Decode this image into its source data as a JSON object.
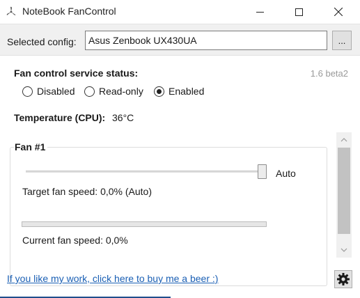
{
  "window": {
    "title": "NoteBook FanControl",
    "icons": {
      "app": "fan-app-icon",
      "minimize": "minimize-icon",
      "maximize": "maximize-icon",
      "close": "close-icon"
    }
  },
  "config": {
    "label": "Selected config:",
    "value": "Asus Zenbook UX430UA",
    "browse_label": "..."
  },
  "version": "1.6 beta2",
  "service": {
    "heading": "Fan control service status:",
    "options": [
      {
        "label": "Disabled",
        "checked": false
      },
      {
        "label": "Read-only",
        "checked": false
      },
      {
        "label": "Enabled",
        "checked": true
      }
    ]
  },
  "temperature": {
    "label": "Temperature (CPU):",
    "value": "36°C"
  },
  "fan": {
    "title": "Fan #1",
    "slider_value_label": "Auto",
    "target_speed_text": "Target fan speed:  0,0% (Auto)",
    "current_speed_text": "Current fan speed:  0,0%",
    "current_speed_fraction": 0.0
  },
  "footer": {
    "link_text": "If you like my work, click here to buy me a beer :)",
    "settings_icon": "gear-icon"
  },
  "colors": {
    "link": "#1a5fb4",
    "version": "#9a9a9a",
    "progress_fill": "#06b025"
  }
}
